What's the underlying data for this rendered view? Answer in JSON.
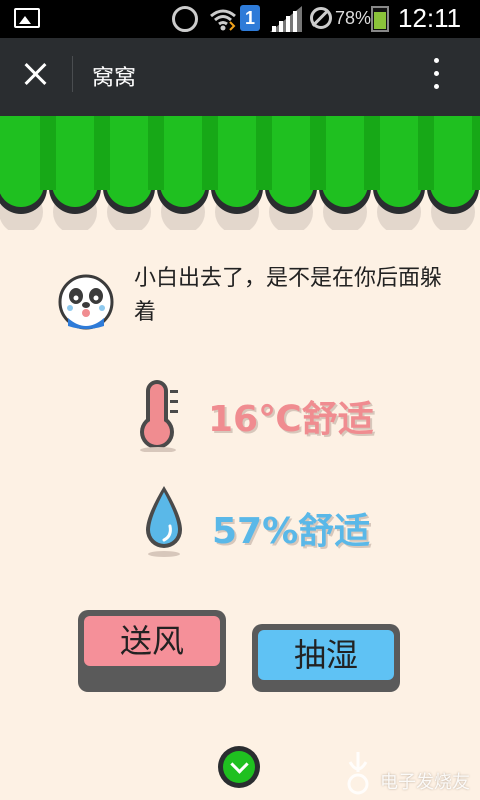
{
  "status_bar": {
    "battery_percent": "78%",
    "battery_level": 0.78,
    "sim_label": "1",
    "time": "12:11"
  },
  "title_bar": {
    "title": "窝窝",
    "close_icon": "close-icon",
    "menu_icon": "more-vertical-icon"
  },
  "main": {
    "message": "小白出去了，是不是在你后面躲着",
    "temperature": {
      "text": "16℃舒适",
      "icon": "thermometer-icon",
      "color": "#f08c90"
    },
    "humidity": {
      "text": "57%舒适",
      "icon": "water-drop-icon",
      "color": "#5ab8e8"
    },
    "buttons": {
      "wind": "送风",
      "dehumidify": "抽湿"
    },
    "more_icon": "chevron-down-icon"
  },
  "watermark": {
    "text": "电子发烧友"
  },
  "colors": {
    "awning_green": "#1fc020",
    "background": "#fdf1e4",
    "header": "#2a2d30"
  }
}
